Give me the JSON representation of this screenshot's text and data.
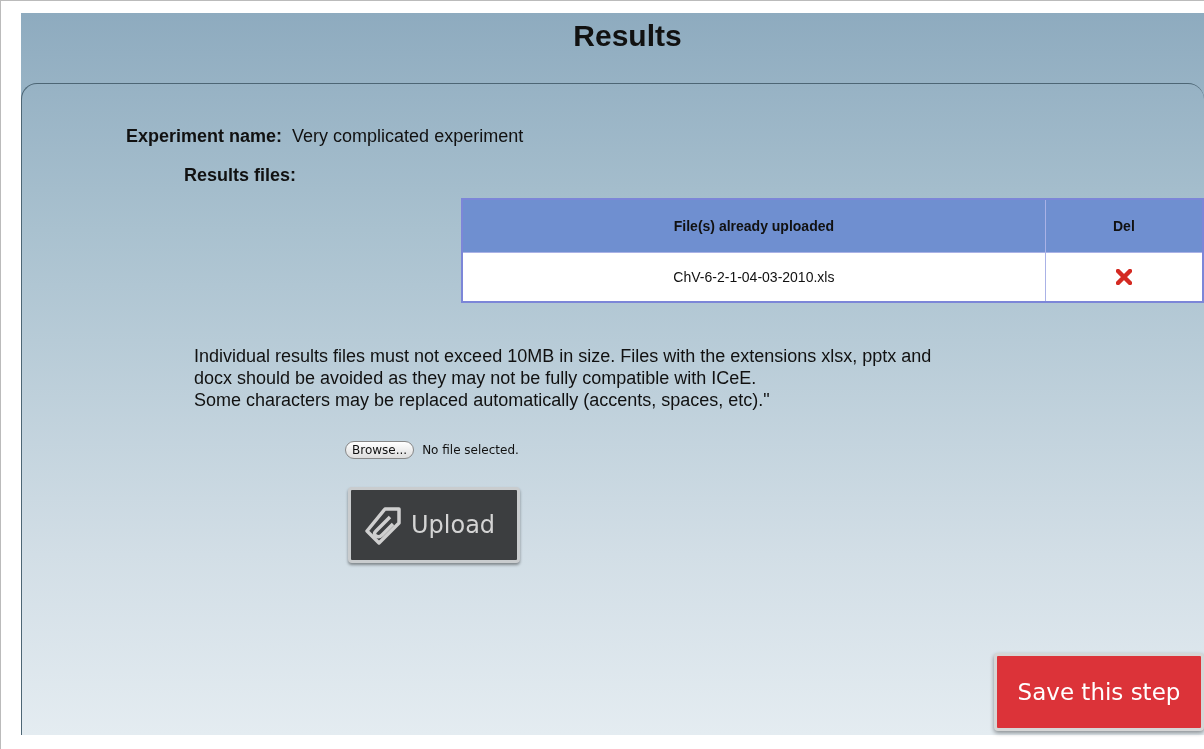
{
  "title": "Results",
  "experiment": {
    "label": "Experiment name:",
    "value": "Very complicated experiment"
  },
  "results_files": {
    "label": "Results files:"
  },
  "table": {
    "columns": [
      "File(s) already uploaded",
      "Del"
    ],
    "rows": [
      {
        "file": "ChV-6-2-1-04-03-2010.xls"
      }
    ]
  },
  "notice": "Individual results files must not exceed 10MB in size. Files with the extensions xlsx, pptx and\ndocx should be avoided as they may not be fully compatible with ICeE.\nSome characters may be replaced automatically (accents, spaces, etc).\"",
  "file_input": {
    "button": "Browse...",
    "status": "No file selected."
  },
  "upload_button": "Upload",
  "save_button": "Save this step"
}
